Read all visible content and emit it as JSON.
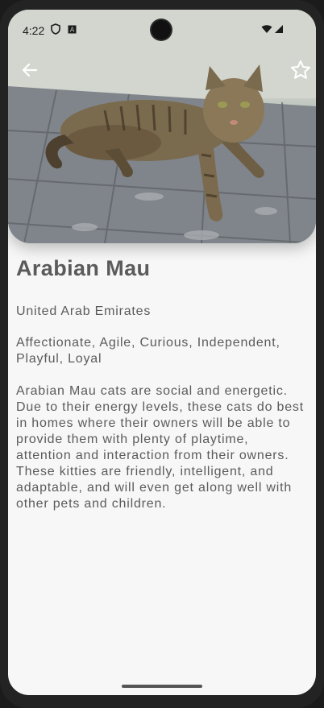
{
  "status": {
    "time": "4:22"
  },
  "breed": {
    "name": "Arabian Mau",
    "origin": "United Arab Emirates",
    "temperament": "Affectionate, Agile, Curious, Independent, Playful, Loyal",
    "description": "Arabian Mau cats are social and energetic. Due to their energy levels, these cats do best in homes where their owners will be able to provide them with plenty of playtime, attention and interaction from their owners. These kitties are friendly, intelligent, and adaptable, and will even get along well with other pets and children."
  },
  "icons": {
    "back": "arrow-back-icon",
    "favorite": "star-outline-icon"
  },
  "colors": {
    "text": "#5b5b5b",
    "background": "#f7f7f7",
    "status_gradient": "#9fd3a8"
  }
}
